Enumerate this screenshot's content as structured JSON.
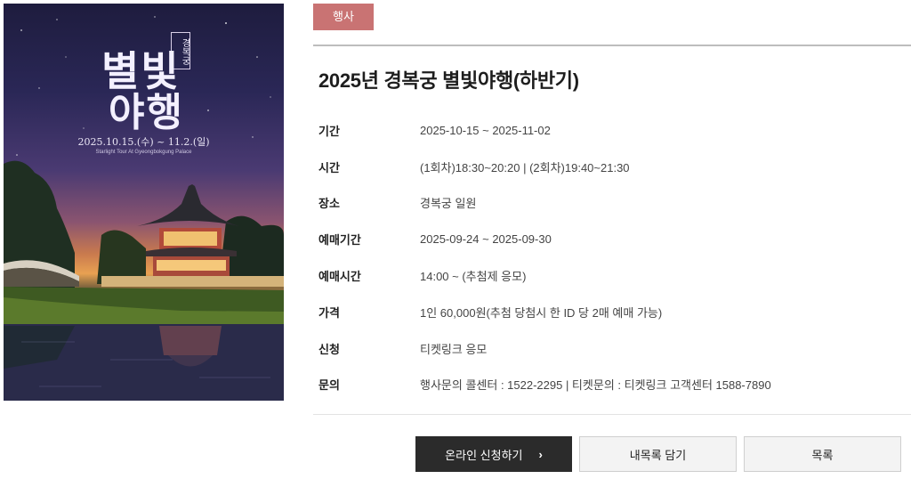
{
  "poster": {
    "title_line1": "별빛",
    "title_line2": "야행",
    "seal": "경복궁",
    "date": "2025.10.15.(수) ~ 11.2.(일)",
    "subtitle": "Starlight Tour At Gyeongbokgung Palace"
  },
  "category": "행사",
  "title": "2025년 경복궁 별빛야행(하반기)",
  "info": [
    {
      "label": "기간",
      "value": "2025-10-15 ~ 2025-11-02"
    },
    {
      "label": "시간",
      "value": "(1회차)18:30~20:20 | (2회차)19:40~21:30"
    },
    {
      "label": "장소",
      "value": "경복궁 일원"
    },
    {
      "label": "예매기간",
      "value": "2025-09-24 ~ 2025-09-30"
    },
    {
      "label": "예매시간",
      "value": "14:00 ~ (추첨제 응모)"
    },
    {
      "label": "가격",
      "value": "1인 60,000원(추첨 당첨시 한 ID 당 2매 예매 가능)"
    },
    {
      "label": "신청",
      "value": "티켓링크 응모"
    },
    {
      "label": "문의",
      "value": "행사문의 콜센터 : 1522-2295 | 티켓문의 : 티켓링크 고객센터 1588-7890"
    }
  ],
  "buttons": {
    "apply": "온라인 신청하기",
    "apply_arrow": "›",
    "add_mylist": "내목록 담기",
    "list": "목록"
  },
  "colors": {
    "category_bg": "#c97373",
    "apply_bg": "#2b2b2b"
  }
}
